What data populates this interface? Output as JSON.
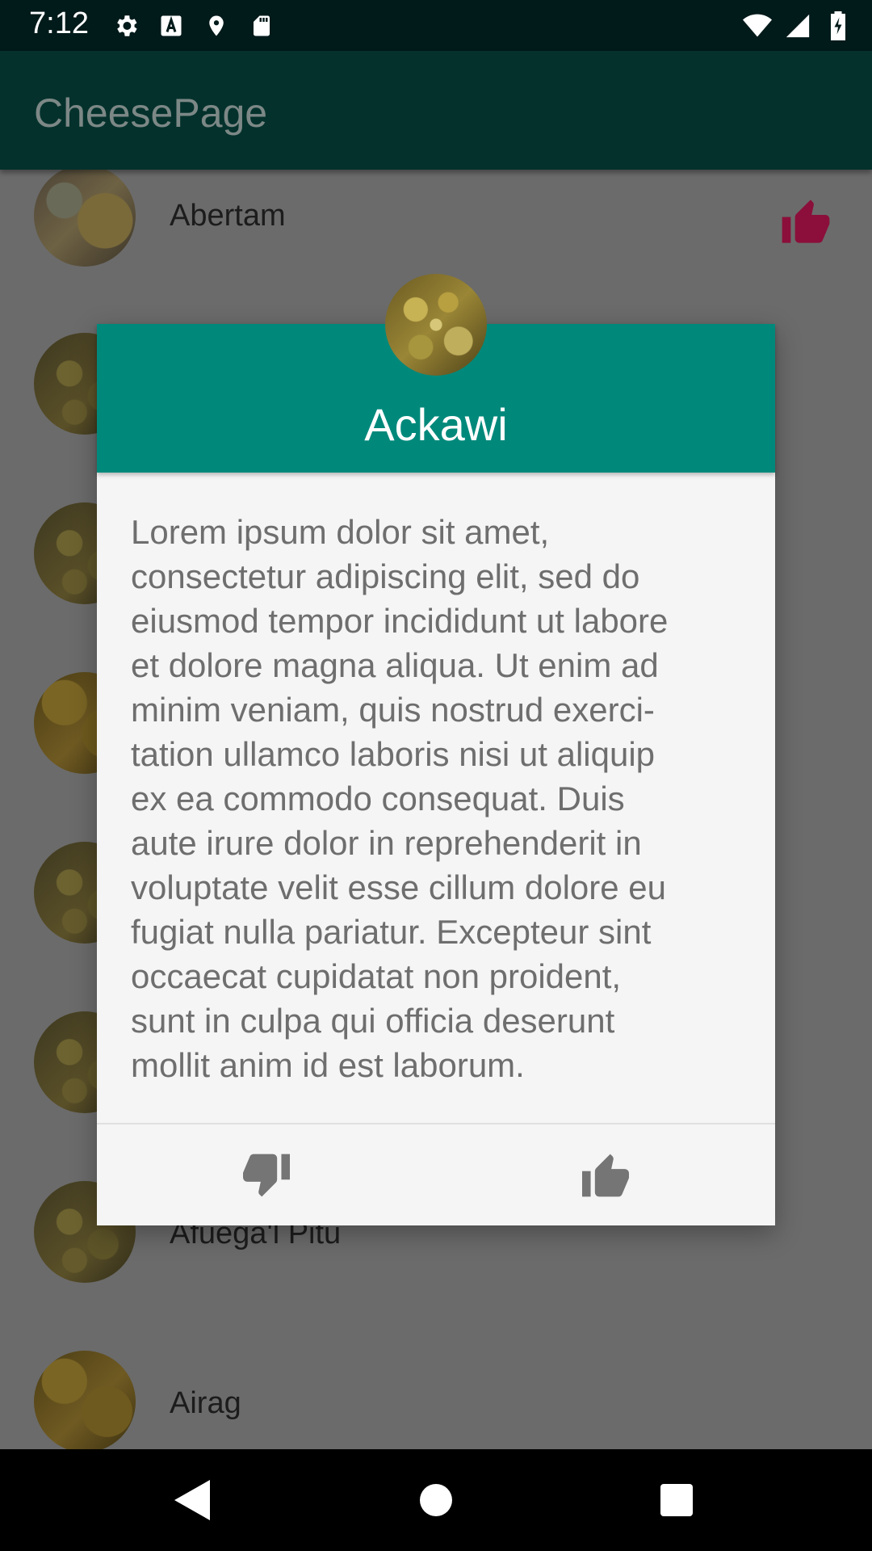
{
  "status_bar": {
    "time": "7:12",
    "left_icons": [
      "settings-icon",
      "a-icon",
      "location-icon",
      "sd-card-icon"
    ],
    "right_icons": [
      "wifi-icon",
      "signal-icon",
      "battery-icon"
    ]
  },
  "app_bar": {
    "title": "CheesePage"
  },
  "list": {
    "items": [
      {
        "label": "Abertam",
        "favorite": true
      },
      {
        "label": "",
        "favorite": false
      },
      {
        "label": "",
        "favorite": false
      },
      {
        "label": "",
        "favorite": false
      },
      {
        "label": "",
        "favorite": false
      },
      {
        "label": "",
        "favorite": false
      },
      {
        "label": "Afuega'l Pitu",
        "favorite": false
      },
      {
        "label": "Airag",
        "favorite": false
      }
    ]
  },
  "dialog": {
    "title": "Ackawi",
    "body": "Lorem ipsum dolor sit amet,\nconsectetur adipiscing elit, sed do\neiusmod tempor incididunt ut labore\net dolore magna aliqua. Ut enim ad\nminim veniam, quis nostrud exerci-\ntation ullamco laboris nisi ut aliquip\nex ea commodo consequat. Duis\naute irure dolor in reprehenderit in\nvoluptate velit esse cillum dolore eu\nfugiat nulla pariatur. Excepteur sint\noccaecat cupidatat non proident,\nsunt in culpa qui officia deserunt\nmollit anim id est laborum.",
    "actions": [
      "thumbs-down-icon",
      "thumbs-up-icon"
    ]
  },
  "colors": {
    "status_bar": "#011a1a",
    "app_bar": "#04312c",
    "dialog_header": "#00897b",
    "dialog_bg": "#f5f5f5",
    "favorite_accent": "#8b0f3a",
    "background_dimmed": "#6b6b6b"
  },
  "nav_bar": {
    "buttons": [
      "back-icon",
      "home-icon",
      "recents-icon"
    ]
  }
}
